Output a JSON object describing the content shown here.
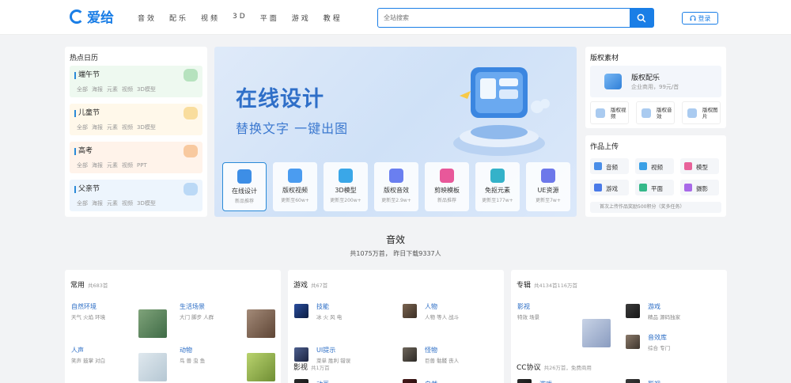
{
  "header": {
    "logo_text": "爱给",
    "logo_sub": "",
    "nav": [
      "音效",
      "配乐",
      "视频",
      "3D",
      "平面",
      "游戏",
      "教程"
    ],
    "search_placeholder": "全站搜索",
    "login_label": "登录"
  },
  "hot_calendar": {
    "title": "热点日历",
    "items": [
      {
        "name": "端午节",
        "tags": [
          "全部",
          "海报",
          "元素",
          "视频",
          "3D模型"
        ],
        "bg": "#eef9f0",
        "deco": "#9ed8a8"
      },
      {
        "name": "儿童节",
        "tags": [
          "全部",
          "海报",
          "元素",
          "视频",
          "3D模型"
        ],
        "bg": "#fff8ea",
        "deco": "#f6d27c"
      },
      {
        "name": "高考",
        "tags": [
          "全部",
          "海报",
          "元素",
          "视频",
          "PPT"
        ],
        "bg": "#fff3ea",
        "deco": "#f5b77f"
      },
      {
        "name": "父亲节",
        "tags": [
          "全部",
          "海报",
          "元素",
          "视频",
          "3D模型"
        ],
        "bg": "#edf5fd",
        "deco": "#a5cdf2"
      }
    ]
  },
  "banner": {
    "title": "在线设计",
    "subtitle": "替换文字  一键出图",
    "quick": [
      {
        "label": "在线设计",
        "sub": "新品推荐",
        "color": "#3d8ee6"
      },
      {
        "label": "版权视频",
        "sub": "更新至60w+",
        "color": "#4b9cf0"
      },
      {
        "label": "3D模型",
        "sub": "更新至200w+",
        "color": "#3aa7e8"
      },
      {
        "label": "版权音效",
        "sub": "更新至2.9w+",
        "color": "#6a7ff0"
      },
      {
        "label": "剪映模板",
        "sub": "新品推荐",
        "color": "#e8589a"
      },
      {
        "label": "免抠元素",
        "sub": "更新至177w+",
        "color": "#34b2c9"
      },
      {
        "label": "UE资源",
        "sub": "更新至7w+",
        "color": "#6d78ea"
      }
    ]
  },
  "copyright": {
    "title": "版权素材",
    "box_title": "版权配乐",
    "box_sub": "企业商用，99元/首",
    "minis": [
      "版权视频",
      "版权音效",
      "版权图片"
    ]
  },
  "upload": {
    "title": "作品上传",
    "buttons": [
      {
        "label": "音频",
        "color": "#4a8ee8"
      },
      {
        "label": "视频",
        "color": "#3aa0e6"
      },
      {
        "label": "模型",
        "color": "#e8629a"
      },
      {
        "label": "游戏",
        "color": "#4a7ae8"
      },
      {
        "label": "平面",
        "color": "#34b889"
      },
      {
        "label": "摄影",
        "color": "#a869e8"
      }
    ],
    "note": "首次上传作品奖励500积分（奖多任务）"
  },
  "section": {
    "title": "音效",
    "subtitle": "共1075万首， 昨日下载9337人"
  },
  "col_common": {
    "title": "常用",
    "count": "共683首",
    "items": [
      {
        "label": "自然环境",
        "tags": "天气 火焰 环境",
        "thumb": "linear-gradient(135deg,#7fa37a,#3f6b46)"
      },
      {
        "label": "生活场景",
        "tags": "大门 脚步 人群",
        "thumb": "linear-gradient(135deg,#a38a78,#5e4535)"
      },
      {
        "label": "人声",
        "tags": "笑声 鼓掌 对白",
        "thumb": "linear-gradient(135deg,#dfe8ee,#b5c7d3)"
      },
      {
        "label": "动物",
        "tags": "鸟 兽 虫 鱼",
        "thumb": "linear-gradient(135deg,#b9d36e,#6f8e34)"
      }
    ]
  },
  "col_game": {
    "title": "游戏",
    "count": "共67首",
    "items": [
      {
        "label": "技能",
        "tags": "冰 火 风 电",
        "thumb": "linear-gradient(135deg,#2a4d9e,#0b1c40)"
      },
      {
        "label": "人物",
        "tags": "人物 等人 战斗",
        "thumb": "linear-gradient(135deg,#7a6450,#3b2e25)"
      },
      {
        "label": "UI提示",
        "tags": "菜单 胜利 错误",
        "thumb": "linear-gradient(135deg,#4d5f8e,#1c2440)"
      },
      {
        "label": "怪物",
        "tags": "巨兽 骷髅 丧人",
        "thumb": "linear-gradient(135deg,#6e665b,#2d2a26)"
      }
    ],
    "video_title": "影视",
    "video_count": "共1万首",
    "video_items": [
      {
        "label": "动画",
        "thumb": "linear-gradient(135deg,#2a2a2a,#111)"
      },
      {
        "label": "自然",
        "thumb": "linear-gradient(135deg,#4a1c1c,#1a0808)"
      }
    ]
  },
  "col_album": {
    "title": "专辑",
    "count": "共4134首116万首",
    "items": [
      {
        "label": "影视",
        "tags": "特效 场景",
        "thumb": "linear-gradient(135deg,#c8d3e6,#8a9cc0)"
      },
      {
        "label": "游戏",
        "tags": "精品 源码独家",
        "thumb": "linear-gradient(135deg,#3c3c3c,#151515)"
      },
      {
        "label": "音效库",
        "tags": "综合 专门",
        "thumb": "linear-gradient(135deg,#8b7a6a,#3d342c)"
      }
    ],
    "cc_title": "CC协议",
    "cc_count": "共26万首，免费商用",
    "cc_items": [
      {
        "label": "游戏",
        "thumb": "linear-gradient(135deg,#2c2c2c,#0f0f0f)"
      },
      {
        "label": "影视",
        "thumb": "linear-gradient(135deg,#3a3a3a,#1a1a1a)"
      }
    ]
  }
}
